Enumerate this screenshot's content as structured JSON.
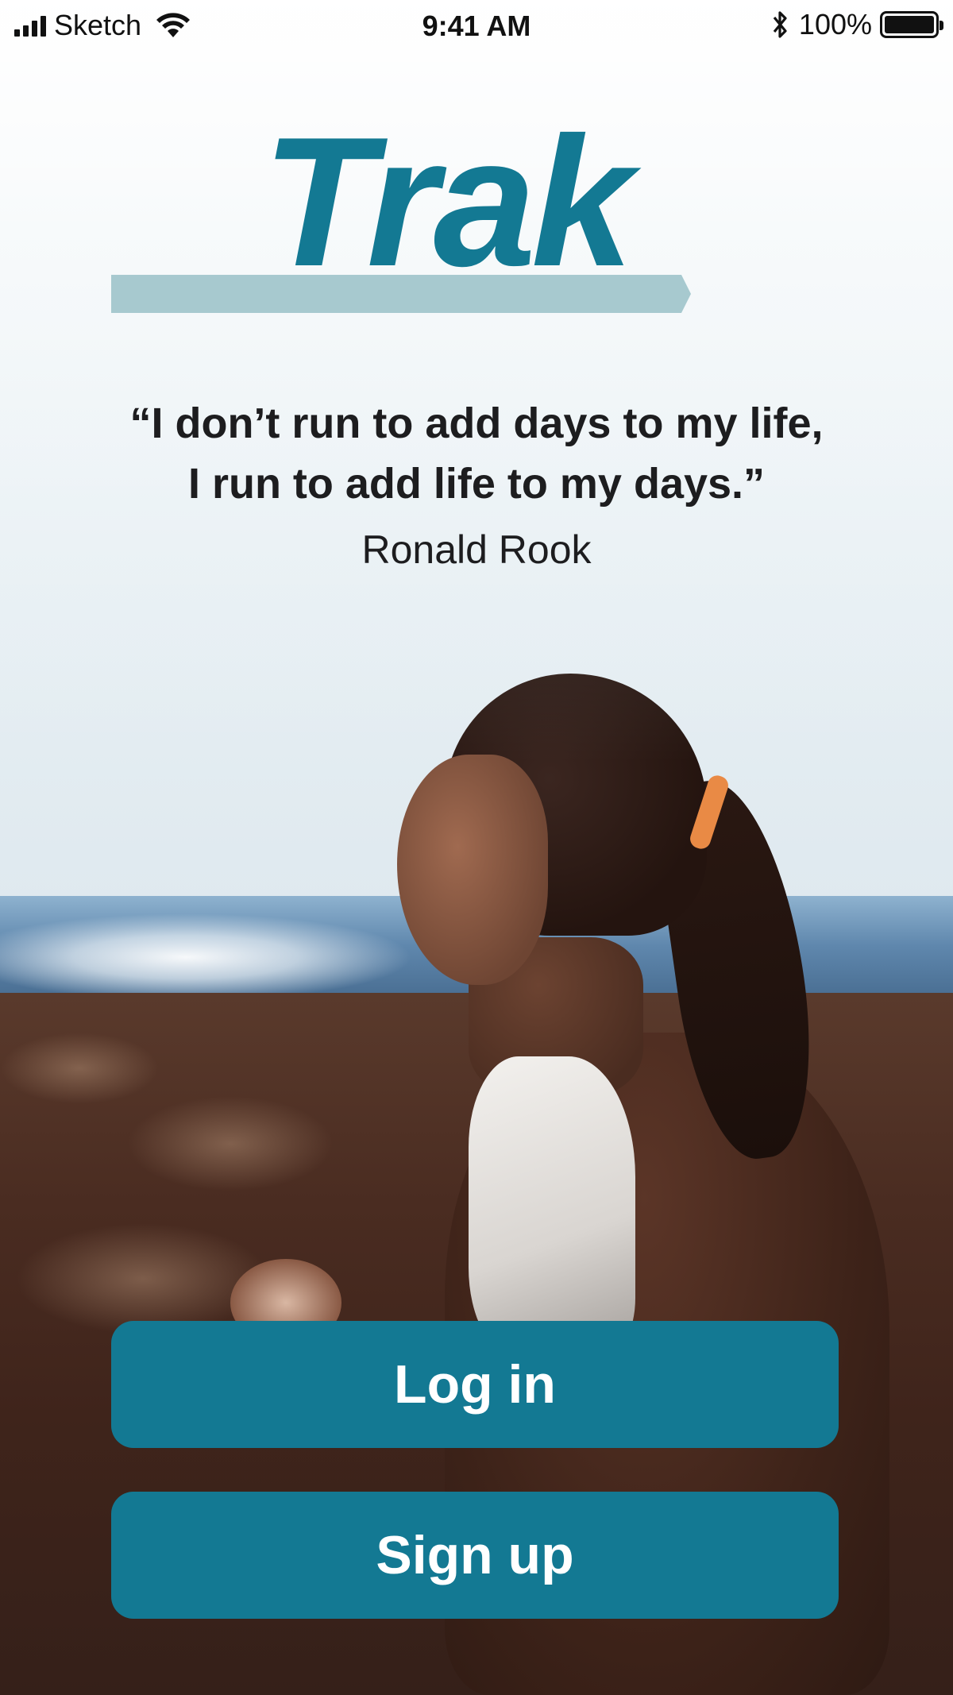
{
  "status_bar": {
    "carrier": "Sketch",
    "time": "9:41 AM",
    "battery_percent": "100%",
    "icons": [
      "signal-icon",
      "wifi-icon",
      "bluetooth-icon",
      "battery-icon"
    ]
  },
  "logo": {
    "text": "Trak",
    "color": "#137993",
    "bar_color": "#a7c9cf"
  },
  "quote": {
    "line1": "“I don’t run to add days to my life,",
    "line2": "I run to add life to my days.”",
    "author": "Ronald Rook"
  },
  "actions": {
    "login_label": "Log in",
    "signup_label": "Sign up",
    "button_color": "#137993"
  }
}
